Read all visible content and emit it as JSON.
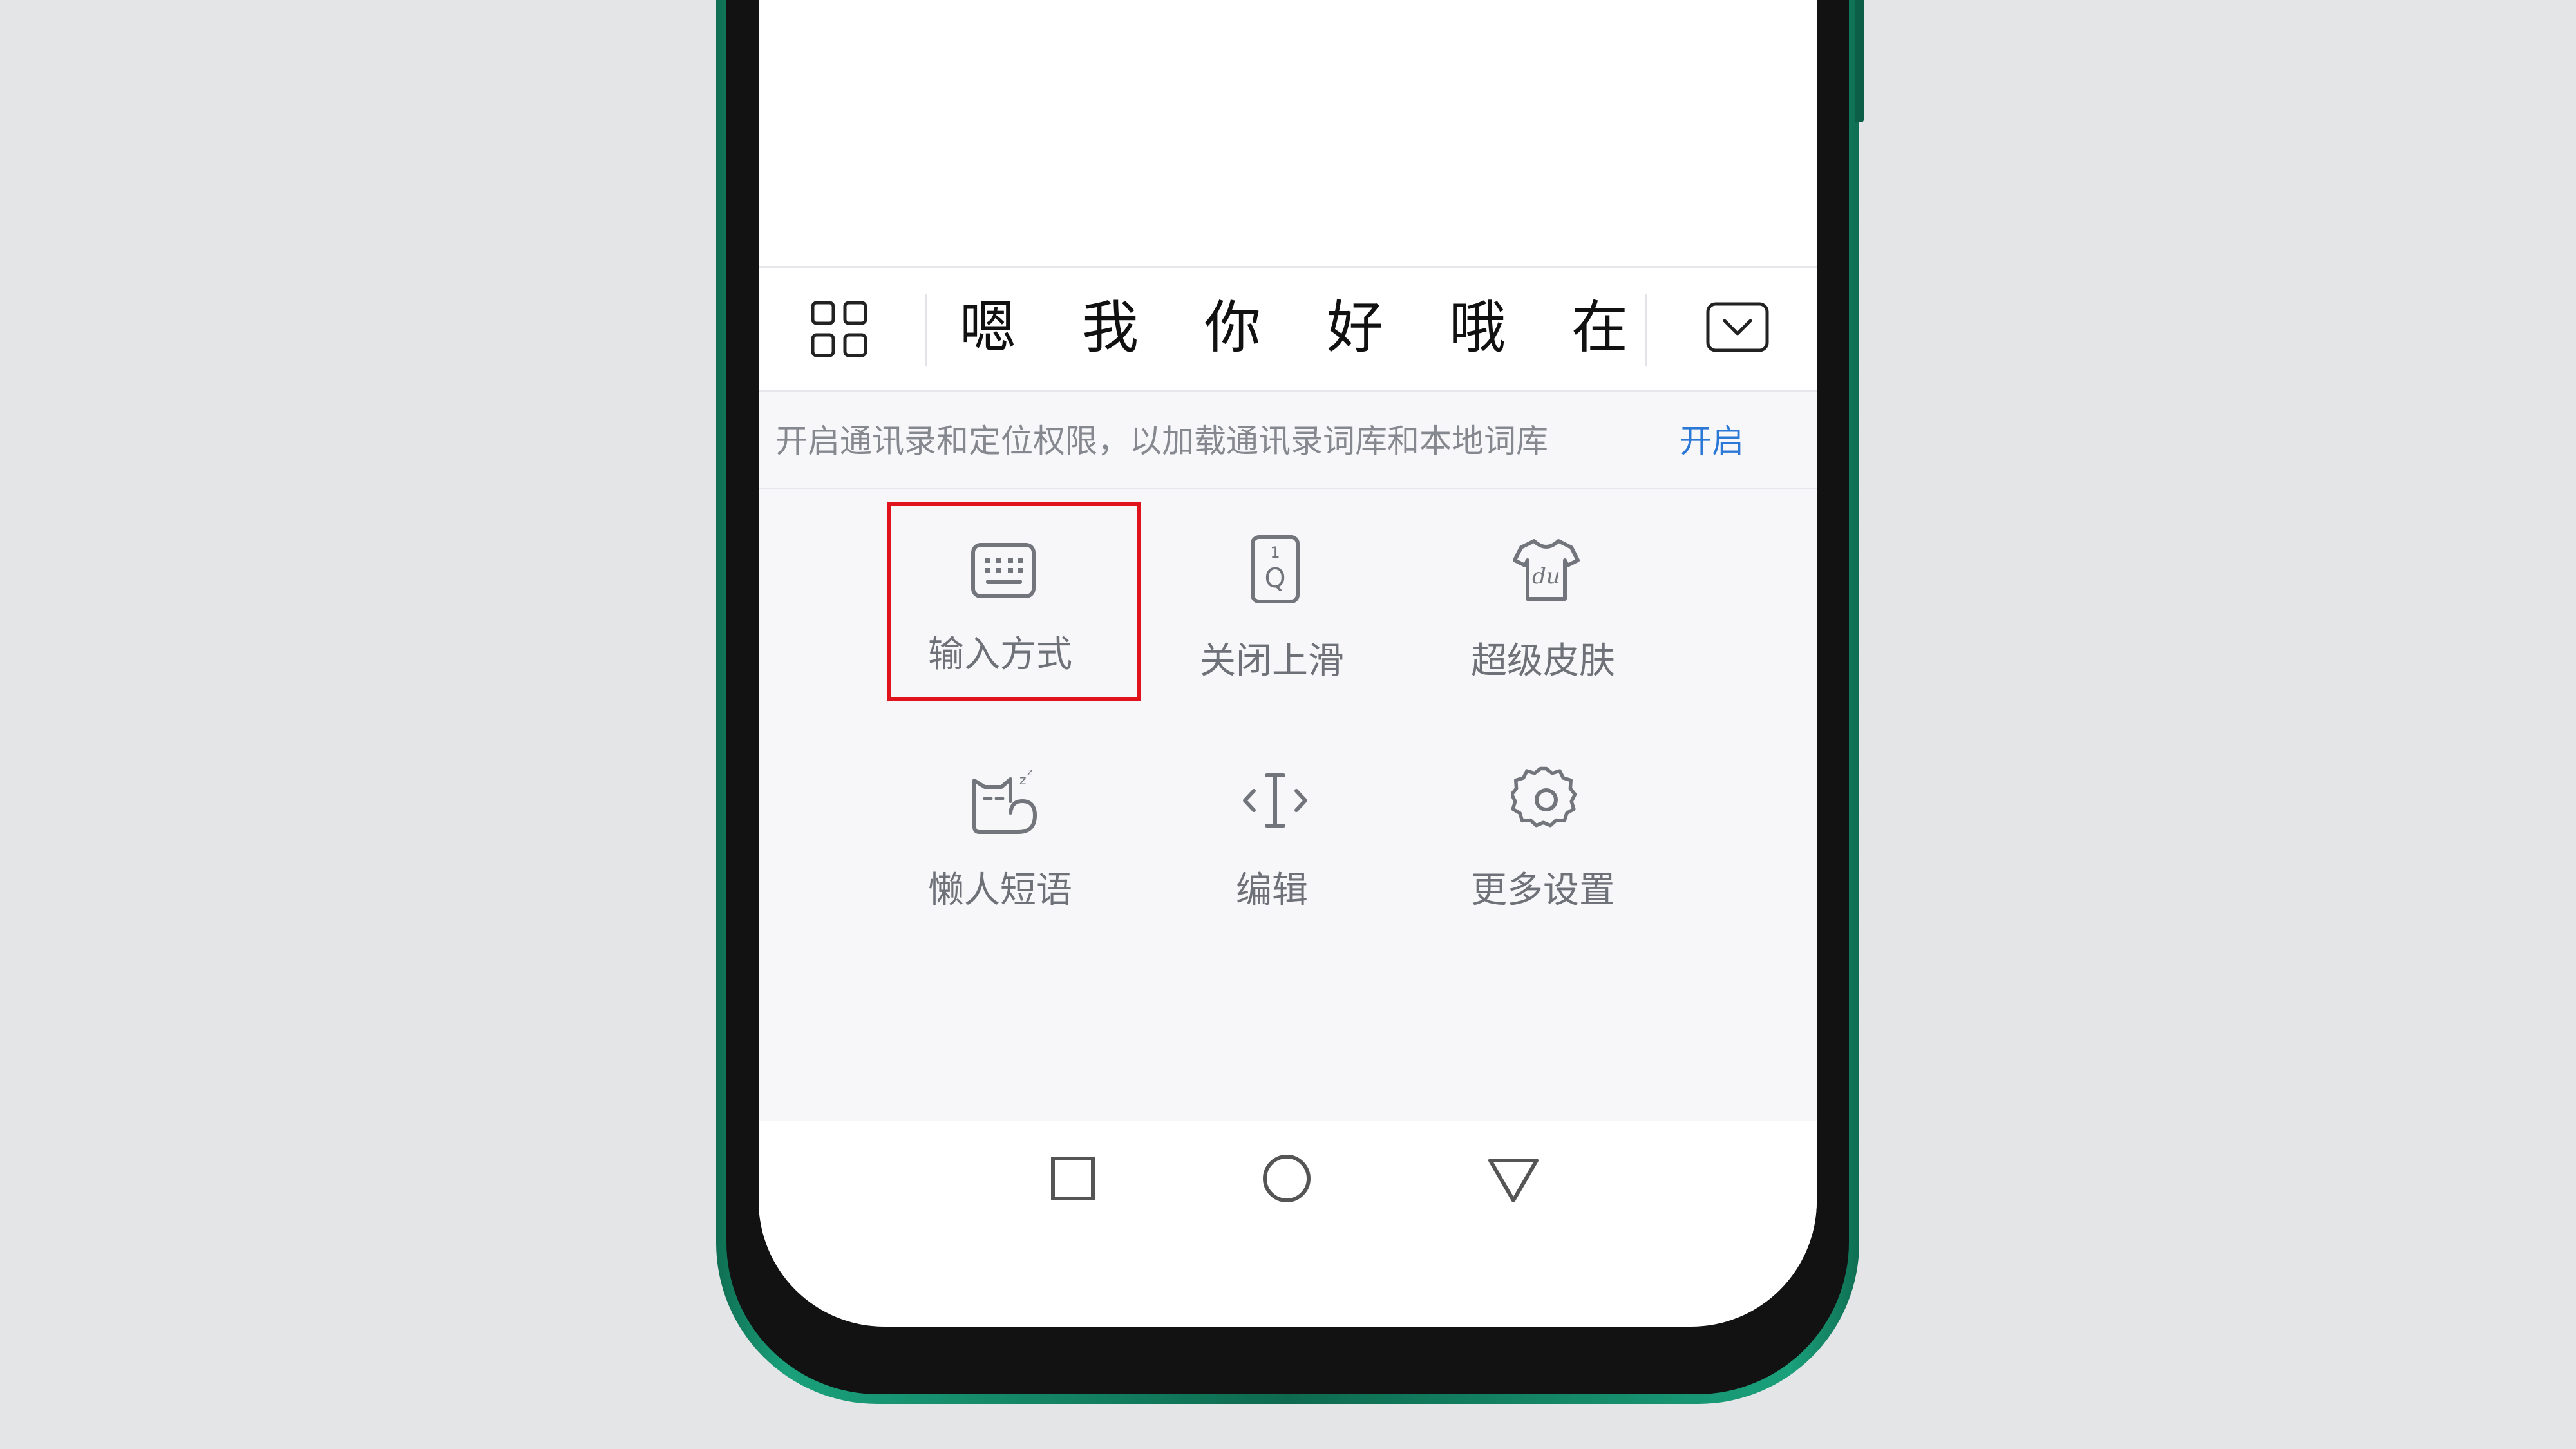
{
  "candidate_bar": {
    "menu_icon": "grid-menu-icon",
    "candidates": [
      "嗯",
      "我",
      "你",
      "好",
      "哦",
      "在"
    ],
    "collapse_icon": "keyboard-collapse-icon"
  },
  "notice": {
    "text": "开启通讯录和定位权限，以加载通讯录词库和本地词库",
    "action": "开启"
  },
  "functions": [
    {
      "label": "输入方式",
      "icon": "keyboard-icon"
    },
    {
      "label": "关闭上滑",
      "icon": "swipe-key-icon"
    },
    {
      "label": "超级皮肤",
      "icon": "tshirt-skin-icon"
    },
    {
      "label": "懒人短语",
      "icon": "sleepy-cat-icon"
    },
    {
      "label": "编辑",
      "icon": "text-cursor-icon"
    },
    {
      "label": "更多设置",
      "icon": "gear-icon"
    }
  ],
  "highlighted_item": "输入方式",
  "nav": {
    "recents_icon": "square-icon",
    "home_icon": "circle-icon",
    "back_icon": "triangle-back-icon"
  },
  "colors": {
    "frame": "#1aa07b",
    "highlight": "#e0131c",
    "link": "#2b78d6",
    "panel_bg": "#f7f7f9"
  }
}
